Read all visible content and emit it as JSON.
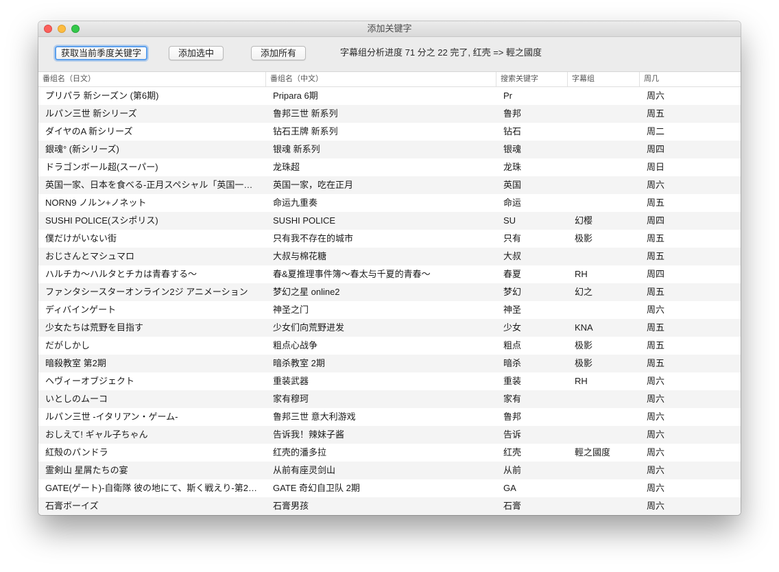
{
  "window": {
    "title": "添加关键字"
  },
  "toolbar": {
    "fetch_label": "获取当前季度关键字",
    "add_selected_label": "添加选中",
    "add_all_label": "添加所有",
    "status": "字幕组分析进度 71 分之 22 完了, 红壳 => 輕之國度"
  },
  "table": {
    "columns": [
      "番组名（日文）",
      "番组名（中文）",
      "搜索关键字",
      "字幕组",
      "周几"
    ],
    "rows": [
      [
        "プリパラ 新シーズン (第6期)",
        "Pripara 6期",
        "Pr",
        "",
        "周六"
      ],
      [
        "ルパン三世 新シリーズ",
        "鲁邦三世 新系列",
        "鲁邦",
        "",
        "周五"
      ],
      [
        "ダイヤのA 新シリーズ",
        "钻石王牌 新系列",
        "钻石",
        "",
        "周二"
      ],
      [
        "銀魂° (新シリーズ)",
        "银魂 新系列",
        "银魂",
        "",
        "周四"
      ],
      [
        "ドラゴンボール超(スーパー)",
        "龙珠超",
        "龙珠",
        "",
        "周日"
      ],
      [
        "英国一家、日本を食べる-正月スペシャル「英国一…",
        "英国一家，吃在正月",
        "英国",
        "",
        "周六"
      ],
      [
        "NORN9 ノルン+ノネット",
        "命运九重奏",
        "命运",
        "",
        "周五"
      ],
      [
        "SUSHI POLICE(スシポリス)",
        "SUSHI POLICE",
        "SU",
        "幻樱",
        "周四"
      ],
      [
        "僕だけがいない街",
        "只有我不存在的城市",
        "只有",
        "极影",
        "周五"
      ],
      [
        "おじさんとマシュマロ",
        "大叔与棉花糖",
        "大叔",
        "",
        "周五"
      ],
      [
        "ハルチカ～ハルタとチカは青春する～",
        "春&夏推理事件簿～春太与千夏的青春～",
        "春夏",
        "RH",
        "周四"
      ],
      [
        "ファンタシースターオンライン2ジ アニメーション",
        "梦幻之星 online2",
        "梦幻",
        "幻之",
        "周五"
      ],
      [
        "ディバインゲート",
        "神圣之门",
        "神圣",
        "",
        "周六"
      ],
      [
        "少女たちは荒野を目指す",
        "少女们向荒野进发",
        "少女",
        "KNA",
        "周五"
      ],
      [
        "だがしかし",
        "粗点心战争",
        "粗点",
        "极影",
        "周五"
      ],
      [
        "暗殺教室 第2期",
        "暗杀教室 2期",
        "暗杀",
        "极影",
        "周五"
      ],
      [
        "ヘヴィーオブジェクト",
        "重装武器",
        "重装",
        "RH",
        "周六"
      ],
      [
        "いとしのムーコ",
        "家有穆珂",
        "家有",
        "",
        "周六"
      ],
      [
        "ルパン三世 -イタリアン・ゲーム-",
        "鲁邦三世 意大利游戏",
        "鲁邦",
        "",
        "周六"
      ],
      [
        "おしえて! ギャル子ちゃん",
        "告诉我！辣妹子酱",
        "告诉",
        "",
        "周六"
      ],
      [
        "紅殻のパンドラ",
        "红壳的潘多拉",
        "红壳",
        "輕之國度",
        "周六"
      ],
      [
        "霊剣山 星屑たちの宴",
        "从前有座灵剑山",
        "从前",
        "",
        "周六"
      ],
      [
        "GATE(ゲート)-自衛隊 彼の地にて、斯く戦えり-第2…",
        "GATE 奇幻自卫队 2期",
        "GA",
        "",
        "周六"
      ],
      [
        "石膏ボーイズ",
        "石膏男孩",
        "石膏",
        "",
        "周六"
      ]
    ]
  }
}
